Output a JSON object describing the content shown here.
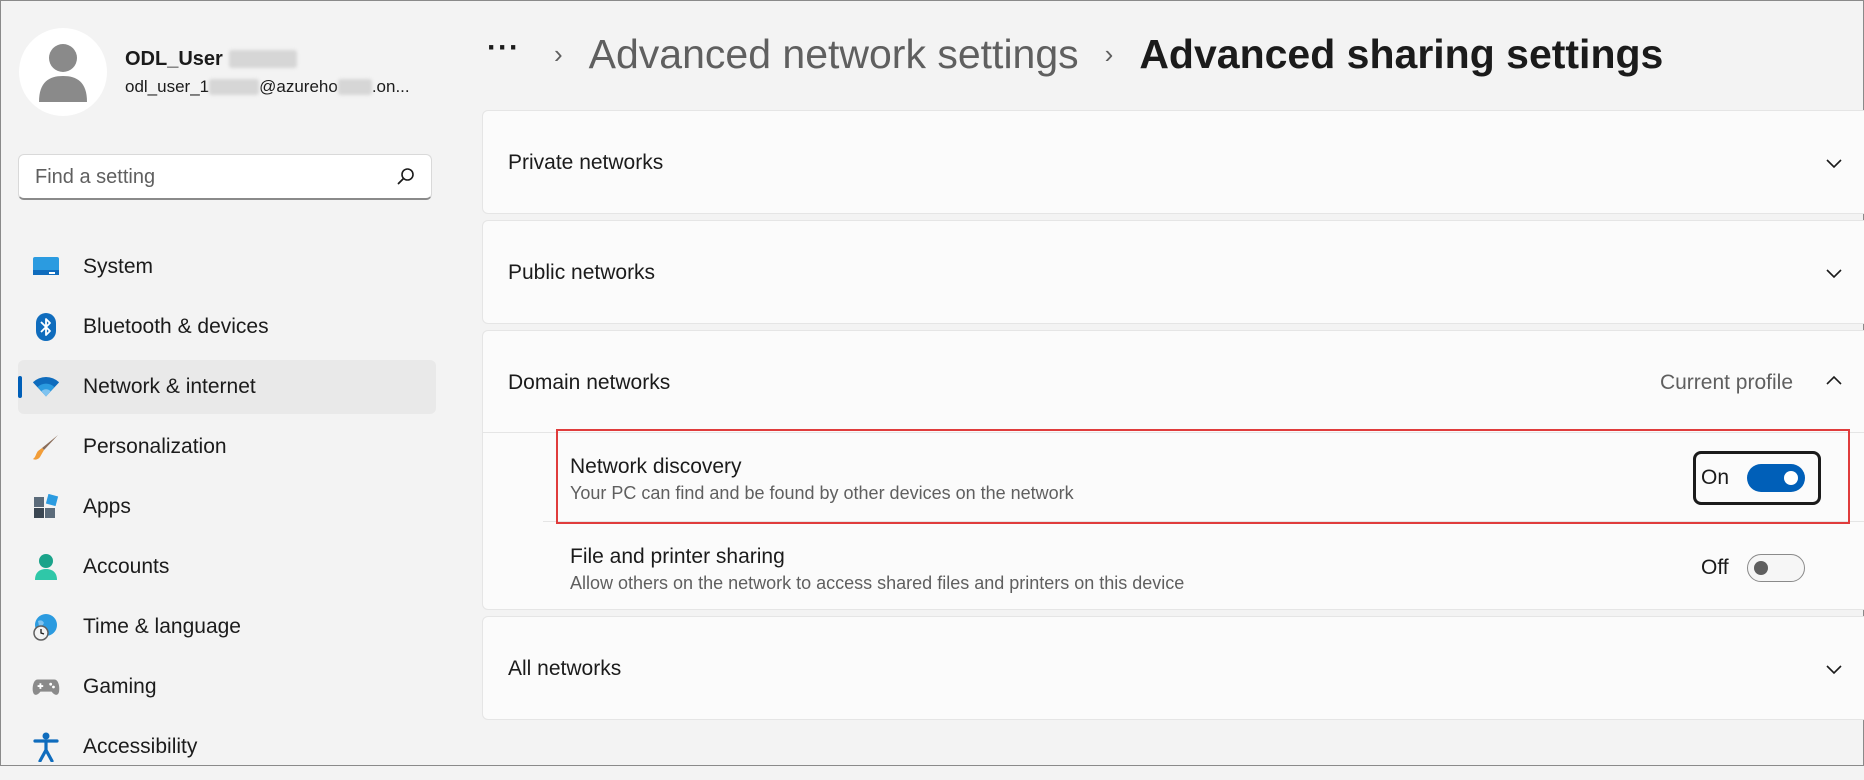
{
  "profile": {
    "name": "ODL_User",
    "email_prefix": "odl_user_1",
    "email_middle": "@azureho",
    "email_suffix": ".on..."
  },
  "search": {
    "placeholder": "Find a setting"
  },
  "sidebar": {
    "items": [
      {
        "label": "System",
        "icon": "system-icon"
      },
      {
        "label": "Bluetooth & devices",
        "icon": "bluetooth-icon"
      },
      {
        "label": "Network & internet",
        "icon": "wifi-icon",
        "active": true
      },
      {
        "label": "Personalization",
        "icon": "brush-icon"
      },
      {
        "label": "Apps",
        "icon": "apps-icon"
      },
      {
        "label": "Accounts",
        "icon": "person-icon"
      },
      {
        "label": "Time & language",
        "icon": "globe-clock-icon"
      },
      {
        "label": "Gaming",
        "icon": "gamepad-icon"
      },
      {
        "label": "Accessibility",
        "icon": "accessibility-icon"
      }
    ]
  },
  "header": {
    "more": "···",
    "parent": "Advanced network settings",
    "current": "Advanced sharing settings"
  },
  "sections": {
    "private": {
      "title": "Private networks"
    },
    "public": {
      "title": "Public networks"
    },
    "domain": {
      "title": "Domain networks",
      "badge": "Current profile",
      "settings": [
        {
          "title": "Network discovery",
          "desc": "Your PC can find and be found by other devices on the network",
          "state": "On"
        },
        {
          "title": "File and printer sharing",
          "desc": "Allow others on the network to access shared files and printers on this device",
          "state": "Off"
        }
      ]
    },
    "all": {
      "title": "All networks"
    }
  },
  "colors": {
    "accent": "#005fb8",
    "highlight": "#e03c3c"
  }
}
